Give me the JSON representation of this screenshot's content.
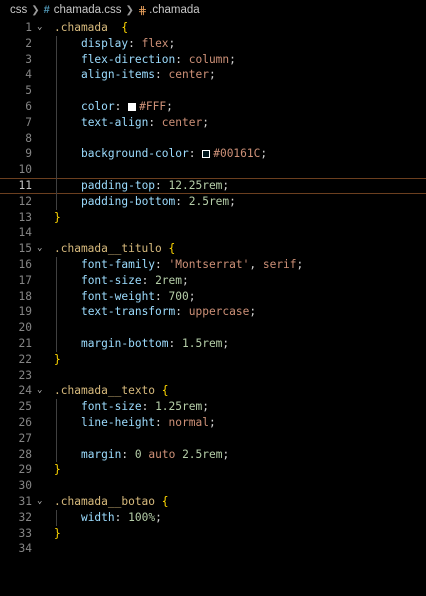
{
  "breadcrumb": {
    "folder": "css",
    "file_icon": "#",
    "file": "chamada.css",
    "symbol": ".chamada"
  },
  "colors": {
    "selector": "#d7ba7d",
    "property": "#9cdcfe",
    "value": "#ce9178",
    "number": "#b5cea8",
    "brace": "#ffd700",
    "swatch_white": "#FFFFFF",
    "swatch_dark": "#00161C",
    "active_line_border": "#6b3f1f"
  },
  "lines": [
    {
      "n": "1",
      "fold": true,
      "tokens": [
        [
          "sel",
          ".chamada"
        ],
        [
          "punc",
          "  "
        ],
        [
          "brace",
          "{"
        ]
      ]
    },
    {
      "n": "2",
      "tokens": [
        [
          "punc",
          "    "
        ],
        [
          "prop",
          "display"
        ],
        [
          "punc",
          ": "
        ],
        [
          "val",
          "flex"
        ],
        [
          "punc",
          ";"
        ]
      ]
    },
    {
      "n": "3",
      "tokens": [
        [
          "punc",
          "    "
        ],
        [
          "prop",
          "flex-direction"
        ],
        [
          "punc",
          ": "
        ],
        [
          "val",
          "column"
        ],
        [
          "punc",
          ";"
        ]
      ]
    },
    {
      "n": "4",
      "tokens": [
        [
          "punc",
          "    "
        ],
        [
          "prop",
          "align-items"
        ],
        [
          "punc",
          ": "
        ],
        [
          "val",
          "center"
        ],
        [
          "punc",
          ";"
        ]
      ]
    },
    {
      "n": "5",
      "tokens": []
    },
    {
      "n": "6",
      "tokens": [
        [
          "punc",
          "    "
        ],
        [
          "prop",
          "color"
        ],
        [
          "punc",
          ": "
        ],
        [
          "swatch",
          "#FFFFFF"
        ],
        [
          "val",
          "#FFF"
        ],
        [
          "punc",
          ";"
        ]
      ]
    },
    {
      "n": "7",
      "tokens": [
        [
          "punc",
          "    "
        ],
        [
          "prop",
          "text-align"
        ],
        [
          "punc",
          ": "
        ],
        [
          "val",
          "center"
        ],
        [
          "punc",
          ";"
        ]
      ]
    },
    {
      "n": "8",
      "tokens": []
    },
    {
      "n": "9",
      "tokens": [
        [
          "punc",
          "    "
        ],
        [
          "prop",
          "background-color"
        ],
        [
          "punc",
          ": "
        ],
        [
          "swatch",
          "#00161C"
        ],
        [
          "val",
          "#00161C"
        ],
        [
          "punc",
          ";"
        ]
      ]
    },
    {
      "n": "10",
      "tokens": []
    },
    {
      "n": "11",
      "active": true,
      "tokens": [
        [
          "punc",
          "    "
        ],
        [
          "prop",
          "padding-top"
        ],
        [
          "punc",
          ": "
        ],
        [
          "num",
          "12.25rem"
        ],
        [
          "punc",
          ";"
        ]
      ]
    },
    {
      "n": "12",
      "tokens": [
        [
          "punc",
          "    "
        ],
        [
          "prop",
          "padding-bottom"
        ],
        [
          "punc",
          ": "
        ],
        [
          "num",
          "2.5rem"
        ],
        [
          "punc",
          ";"
        ]
      ]
    },
    {
      "n": "13",
      "tokens": [
        [
          "brace",
          "}"
        ]
      ]
    },
    {
      "n": "14",
      "tokens": []
    },
    {
      "n": "15",
      "fold": true,
      "tokens": [
        [
          "sel",
          ".chamada__titulo"
        ],
        [
          "punc",
          " "
        ],
        [
          "brace",
          "{"
        ]
      ]
    },
    {
      "n": "16",
      "tokens": [
        [
          "punc",
          "    "
        ],
        [
          "prop",
          "font-family"
        ],
        [
          "punc",
          ": "
        ],
        [
          "val",
          "'Montserrat'"
        ],
        [
          "punc",
          ", "
        ],
        [
          "val",
          "serif"
        ],
        [
          "punc",
          ";"
        ]
      ]
    },
    {
      "n": "17",
      "tokens": [
        [
          "punc",
          "    "
        ],
        [
          "prop",
          "font-size"
        ],
        [
          "punc",
          ": "
        ],
        [
          "num",
          "2rem"
        ],
        [
          "punc",
          ";"
        ]
      ]
    },
    {
      "n": "18",
      "tokens": [
        [
          "punc",
          "    "
        ],
        [
          "prop",
          "font-weight"
        ],
        [
          "punc",
          ": "
        ],
        [
          "num",
          "700"
        ],
        [
          "punc",
          ";"
        ]
      ]
    },
    {
      "n": "19",
      "tokens": [
        [
          "punc",
          "    "
        ],
        [
          "prop",
          "text-transform"
        ],
        [
          "punc",
          ": "
        ],
        [
          "val",
          "uppercase"
        ],
        [
          "punc",
          ";"
        ]
      ]
    },
    {
      "n": "20",
      "tokens": []
    },
    {
      "n": "21",
      "tokens": [
        [
          "punc",
          "    "
        ],
        [
          "prop",
          "margin-bottom"
        ],
        [
          "punc",
          ": "
        ],
        [
          "num",
          "1.5rem"
        ],
        [
          "punc",
          ";"
        ]
      ]
    },
    {
      "n": "22",
      "tokens": [
        [
          "brace",
          "}"
        ]
      ]
    },
    {
      "n": "23",
      "tokens": []
    },
    {
      "n": "24",
      "fold": true,
      "tokens": [
        [
          "sel",
          ".chamada__texto"
        ],
        [
          "punc",
          " "
        ],
        [
          "brace",
          "{"
        ]
      ]
    },
    {
      "n": "25",
      "tokens": [
        [
          "punc",
          "    "
        ],
        [
          "prop",
          "font-size"
        ],
        [
          "punc",
          ": "
        ],
        [
          "num",
          "1.25rem"
        ],
        [
          "punc",
          ";"
        ]
      ]
    },
    {
      "n": "26",
      "tokens": [
        [
          "punc",
          "    "
        ],
        [
          "prop",
          "line-height"
        ],
        [
          "punc",
          ": "
        ],
        [
          "val",
          "normal"
        ],
        [
          "punc",
          ";"
        ]
      ]
    },
    {
      "n": "27",
      "tokens": []
    },
    {
      "n": "28",
      "tokens": [
        [
          "punc",
          "    "
        ],
        [
          "prop",
          "margin"
        ],
        [
          "punc",
          ": "
        ],
        [
          "num",
          "0"
        ],
        [
          "punc",
          " "
        ],
        [
          "val",
          "auto"
        ],
        [
          "punc",
          " "
        ],
        [
          "num",
          "2.5rem"
        ],
        [
          "punc",
          ";"
        ]
      ]
    },
    {
      "n": "29",
      "tokens": [
        [
          "brace",
          "}"
        ]
      ]
    },
    {
      "n": "30",
      "tokens": []
    },
    {
      "n": "31",
      "fold": true,
      "tokens": [
        [
          "sel",
          ".chamada__botao"
        ],
        [
          "punc",
          " "
        ],
        [
          "brace",
          "{"
        ]
      ]
    },
    {
      "n": "32",
      "tokens": [
        [
          "punc",
          "    "
        ],
        [
          "prop",
          "width"
        ],
        [
          "punc",
          ": "
        ],
        [
          "num",
          "100%"
        ],
        [
          "punc",
          ";"
        ]
      ]
    },
    {
      "n": "33",
      "tokens": [
        [
          "brace",
          "}"
        ]
      ]
    },
    {
      "n": "34",
      "tokens": []
    }
  ]
}
